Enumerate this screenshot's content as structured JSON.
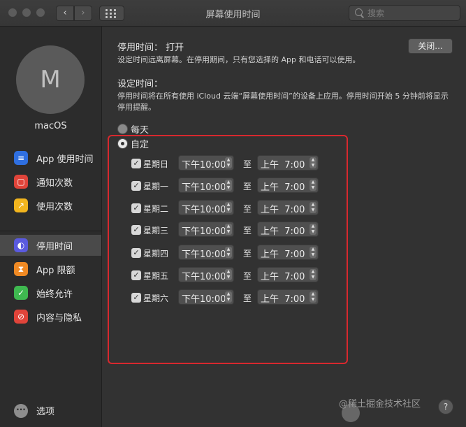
{
  "window": {
    "title": "屏幕使用时间"
  },
  "search": {
    "placeholder": "搜索"
  },
  "sidebar": {
    "avatar_letter": "M",
    "username": "macOS",
    "items": [
      {
        "label": "App 使用时间",
        "icon": "layers-icon",
        "color": "#2f6fe0",
        "glyph": "≡"
      },
      {
        "label": "通知次数",
        "icon": "notification-icon",
        "color": "#e0443a",
        "glyph": "▢"
      },
      {
        "label": "使用次数",
        "icon": "pickups-icon",
        "color": "#f2b51e",
        "glyph": "↗"
      },
      {
        "label": "停用时间",
        "icon": "downtime-icon",
        "color": "#5a5adf",
        "glyph": "◐"
      },
      {
        "label": "App 限额",
        "icon": "hourglass-icon",
        "color": "#f08a24",
        "glyph": "⧗"
      },
      {
        "label": "始终允许",
        "icon": "checkmark-icon",
        "color": "#3fb950",
        "glyph": "✓"
      },
      {
        "label": "内容与隐私",
        "icon": "restriction-icon",
        "color": "#e0443a",
        "glyph": "⊘"
      }
    ],
    "options_label": "选项"
  },
  "main": {
    "downtime_heading": "停用时间：  打开",
    "downtime_desc": "设定时间远离屏幕。在停用期间，只有您选择的 App 和电话可以使用。",
    "close_button": "关闭...",
    "schedule_heading": "设定时间：",
    "schedule_desc_1": "停用时间将在所有使用 iCloud 云端“屏幕使用时间”的设备上应用。停用时间开始 5 分钟前将显示",
    "schedule_desc_2": "停用提醒。",
    "option_every_day": "每天",
    "option_custom": "自定",
    "to_word": "至",
    "days": [
      {
        "day": "星期日",
        "from": "下午10:00",
        "to": "上午  7:00"
      },
      {
        "day": "星期一",
        "from": "下午10:00",
        "to": "上午  7:00"
      },
      {
        "day": "星期二",
        "from": "下午10:00",
        "to": "上午  7:00"
      },
      {
        "day": "星期三",
        "from": "下午10:00",
        "to": "上午  7:00"
      },
      {
        "day": "星期四",
        "from": "下午10:00",
        "to": "上午  7:00"
      },
      {
        "day": "星期五",
        "from": "下午10:00",
        "to": "上午  7:00"
      },
      {
        "day": "星期六",
        "from": "下午10:00",
        "to": "上午  7:00"
      }
    ],
    "help_glyph": "?"
  },
  "watermark": {
    "text": "@稀土掘金技术社区"
  },
  "colors": {
    "highlight": "#d8282e",
    "accent": "#2f6fe0"
  }
}
